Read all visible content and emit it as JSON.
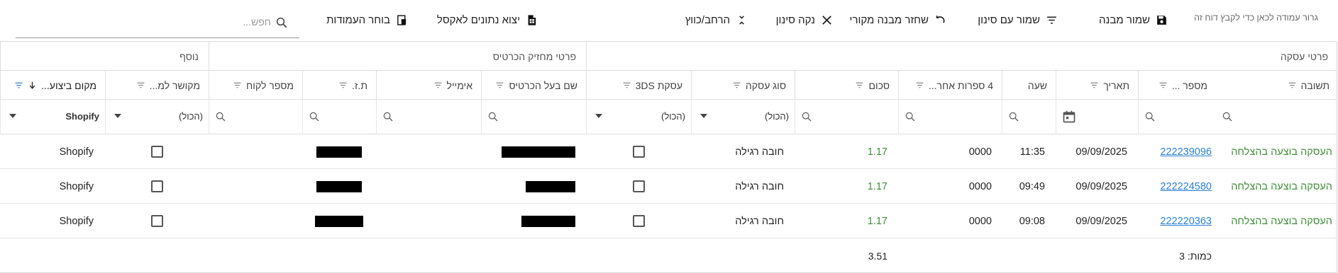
{
  "toolbar": {
    "drop_hint": "גרור עמודה לכאן כדי לקבץ דוח זה",
    "save_layout": "שמור מבנה",
    "save_with_filter": "שמור עם סינון",
    "restore_original": "שחזר מבנה מקורי",
    "clear_filter": "נקה סינון",
    "expand_collapse": "הרחב/כווץ",
    "export_excel": "יצוא נתונים לאקסל",
    "column_chooser": "בוחר העמודות",
    "search_placeholder": "חפש..."
  },
  "groups": {
    "transaction_details": "פרטי עסקה",
    "cardholder_details": "פרטי מחזיק הכרטיס",
    "additional": "נוסף"
  },
  "columns": {
    "response": "תשובה",
    "number": "מספר ...",
    "date": "תאריך",
    "time": "שעה",
    "last4": "4 ספרות אחר...",
    "amount": "סכום",
    "deal_type": "סוג עסקה",
    "deal_3ds": "עסקת 3DS",
    "cardholder_name": "שם בעל הכרטיס",
    "email": "אימייל",
    "id": "ת.ז.",
    "customer_number": "מספר לקוח",
    "linked": "מקושר למ...",
    "execution_place": "מקום ביצוע..."
  },
  "filters": {
    "all": "(הכול)",
    "place": "Shopify"
  },
  "rows": [
    {
      "response": "העסקה בוצעה בהצלחה",
      "number": "222239096",
      "date": "09/09/2025",
      "time": "11:35",
      "last4": "0000",
      "amount": "1.17",
      "deal_type": "חובה רגילה",
      "place": "Shopify"
    },
    {
      "response": "העסקה בוצעה בהצלחה",
      "number": "222224580",
      "date": "09/09/2025",
      "time": "09:49",
      "last4": "0000",
      "amount": "1.17",
      "deal_type": "חובה רגילה",
      "place": "Shopify"
    },
    {
      "response": "העסקה בוצעה בהצלחה",
      "number": "222220363",
      "date": "09/09/2025",
      "time": "09:08",
      "last4": "0000",
      "amount": "1.17",
      "deal_type": "חובה רגילה",
      "place": "Shopify"
    }
  ],
  "footer": {
    "count": "כמות: 3",
    "total": "3.51"
  },
  "colors": {
    "success_green": "#3f8f37",
    "link_blue": "#2a7fd4",
    "sort_blue": "#2a7fd4"
  }
}
